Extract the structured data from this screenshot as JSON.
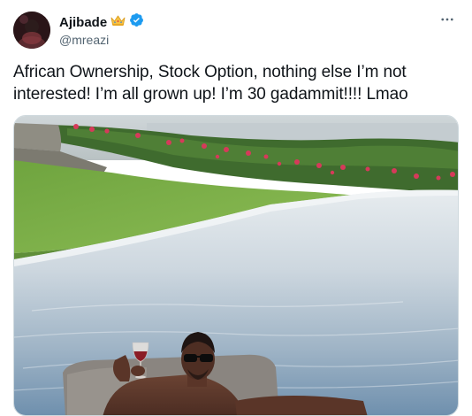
{
  "tweet": {
    "author": {
      "display_name": "Ajibade",
      "handle": "@mreazi",
      "emoji_icon": "crown-icon",
      "verified_icon": "verified-badge-icon",
      "verified_color": "#1d9bf0"
    },
    "text": "African Ownership, Stock Option, nothing else I’m not interested! I’m all grown up! I’m 30 gadammit!!!! Lmao",
    "more_icon": "more-horizontal-icon",
    "media": {
      "type": "photo"
    }
  },
  "colors": {
    "text_primary": "#0f1419",
    "text_secondary": "#536471",
    "border": "#cfd9de"
  }
}
